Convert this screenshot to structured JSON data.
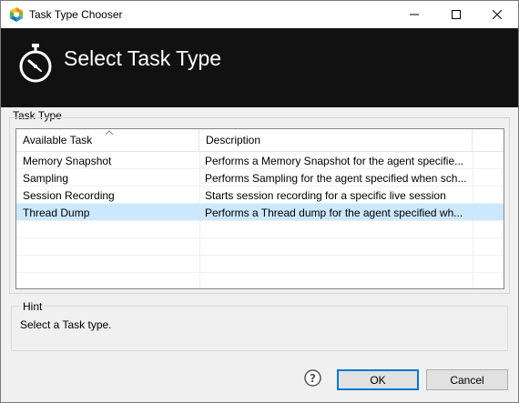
{
  "window": {
    "title": "Task Type Chooser"
  },
  "banner": {
    "title": "Select Task Type"
  },
  "task_type_group": {
    "label": "Task Type",
    "columns": [
      "Available Task",
      "Description"
    ],
    "rows": [
      {
        "task": "Memory Snapshot",
        "description": "Performs a Memory Snapshot for the agent specifie..."
      },
      {
        "task": "Sampling",
        "description": "Performs Sampling for the agent specified when sch..."
      },
      {
        "task": "Session Recording",
        "description": "Starts session recording for a specific live session"
      },
      {
        "task": "Thread Dump",
        "description": "Performs a Thread dump for the agent specified wh..."
      }
    ],
    "selected_index": 3
  },
  "hint": {
    "label": "Hint",
    "text": "Select a Task type."
  },
  "footer": {
    "ok_label": "OK",
    "cancel_label": "Cancel"
  },
  "colors": {
    "banner_bg": "#111111",
    "selected_row": "#cce8ff",
    "default_button_border": "#0078d7"
  },
  "icons": {
    "app": "app-logo-icon",
    "banner": "stopwatch-icon",
    "help": "help-icon"
  }
}
